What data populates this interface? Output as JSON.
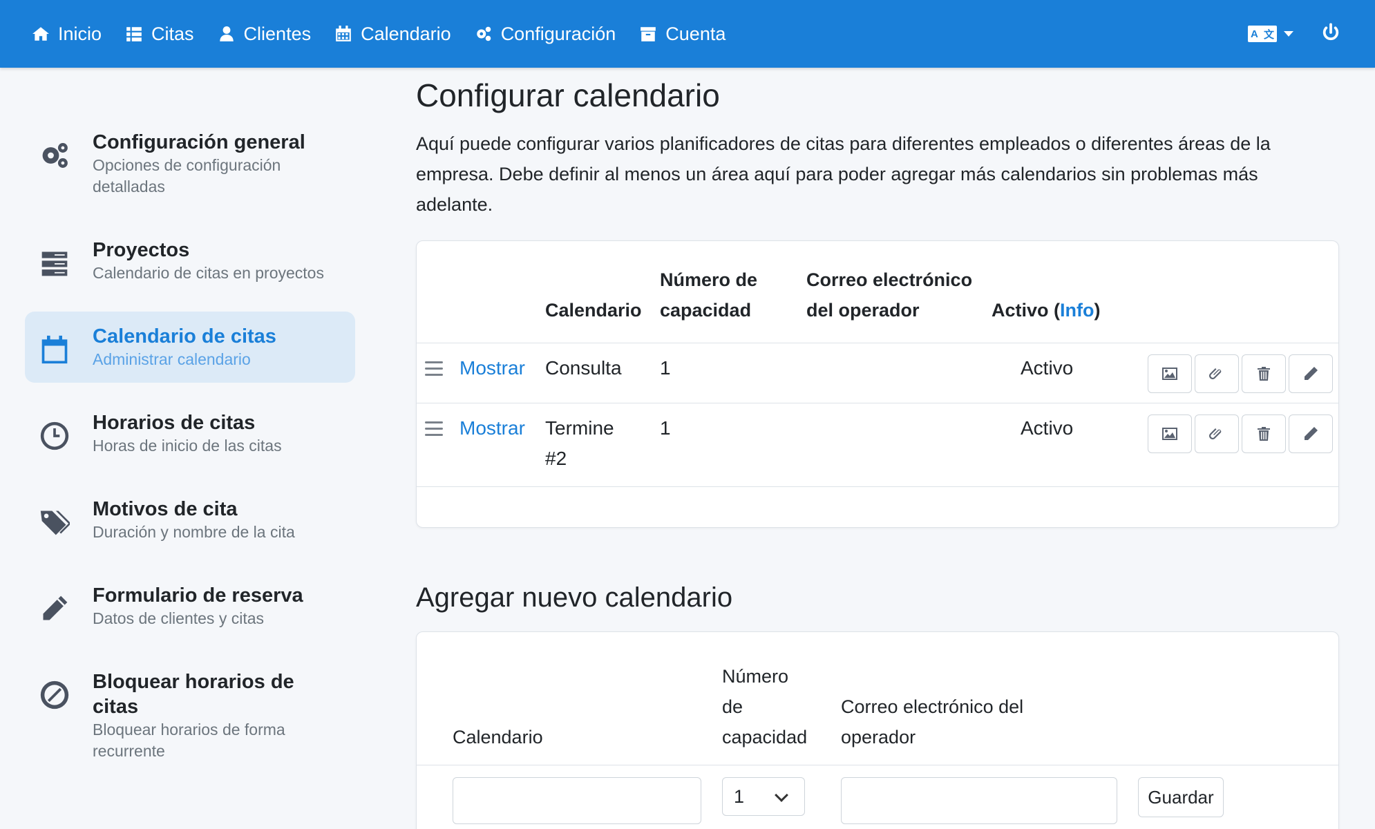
{
  "nav": {
    "items": [
      {
        "label": "Inicio",
        "icon": "home-icon"
      },
      {
        "label": "Citas",
        "icon": "list-icon"
      },
      {
        "label": "Clientes",
        "icon": "user-icon"
      },
      {
        "label": "Calendario",
        "icon": "calendar-icon"
      },
      {
        "label": "Configuración",
        "icon": "gears-icon"
      },
      {
        "label": "Cuenta",
        "icon": "archive-icon"
      }
    ],
    "lang_left": "A",
    "lang_right": "文",
    "accent": "#1a7fd8"
  },
  "sidebar": {
    "items": [
      {
        "title": "Configuración general",
        "subtitle": "Opciones de configuración detalladas",
        "icon": "gears-icon",
        "active": false
      },
      {
        "title": "Proyectos",
        "subtitle": "Calendario de citas en proyectos",
        "icon": "server-icon",
        "active": false
      },
      {
        "title": "Calendario de citas",
        "subtitle": "Administrar calendario",
        "icon": "calendar-icon",
        "active": true
      },
      {
        "title": "Horarios de citas",
        "subtitle": "Horas de inicio de las citas",
        "icon": "clock-icon",
        "active": false
      },
      {
        "title": "Motivos de cita",
        "subtitle": "Duración y nombre de la cita",
        "icon": "tags-icon",
        "active": false
      },
      {
        "title": "Formulario de reserva",
        "subtitle": "Datos de clientes y citas",
        "icon": "pencil-icon",
        "active": false
      },
      {
        "title": "Bloquear horarios de citas",
        "subtitle": "Bloquear horarios de forma recurrente",
        "icon": "ban-icon",
        "active": false
      }
    ]
  },
  "main": {
    "title": "Configurar calendario",
    "intro": "Aquí puede configurar varios planificadores de citas para diferentes empleados o diferentes áreas de la empresa. Debe definir al menos un área aquí para poder agregar más calendarios sin problemas más adelante.",
    "table": {
      "headers": {
        "calendar": "Calendario",
        "capacity_1": "Número de",
        "capacity_2": "capacidad",
        "email_1": "Correo electrónico",
        "email_2": "del operador",
        "active": "Activo (",
        "active_info": "Info",
        "active_close": ")"
      },
      "rows": [
        {
          "show": "Mostrar",
          "name": "Consulta",
          "capacity": "1",
          "email": "",
          "active": "Activo"
        },
        {
          "show": "Mostrar",
          "name": "Termine #2",
          "capacity": "1",
          "email": "",
          "active": "Activo"
        }
      ]
    },
    "add": {
      "title": "Agregar nuevo calendario",
      "headers": {
        "calendar": "Calendario",
        "capacity_1": "Número",
        "capacity_2": "de",
        "capacity_3": "capacidad",
        "email_1": "Correo electrónico del",
        "email_2": "operador"
      },
      "capacity_value": "1",
      "calendar_value": "",
      "email_value": "",
      "save_label": "Guardar"
    }
  }
}
